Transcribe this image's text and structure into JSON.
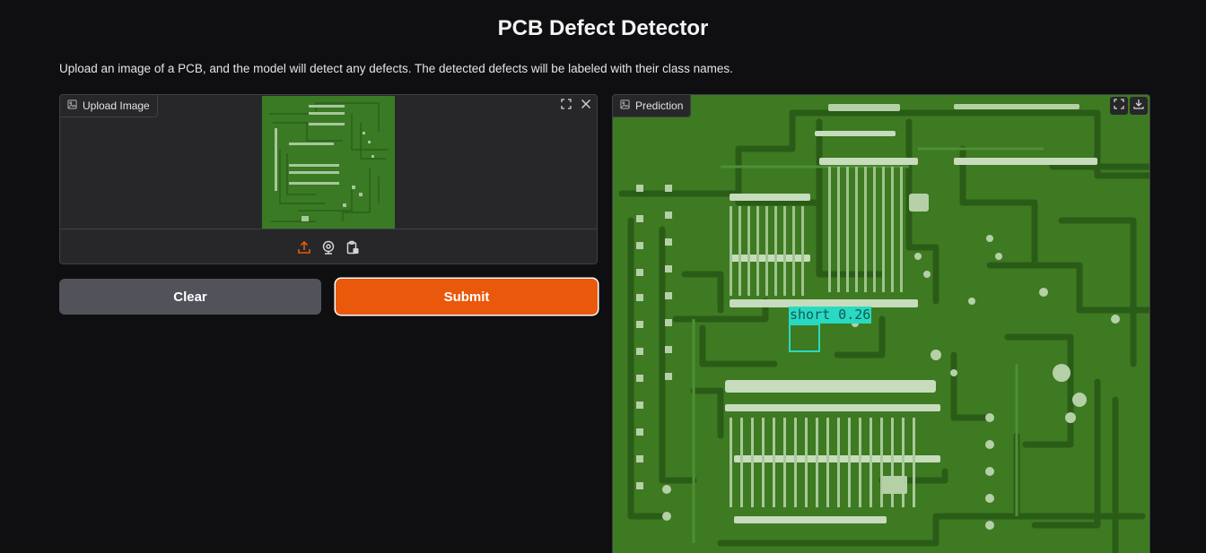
{
  "header": {
    "title": "PCB Defect Detector",
    "description": "Upload an image of a PCB, and the model will detect any defects. The detected defects will be labeled with their class names."
  },
  "upload": {
    "label": "Upload Image",
    "label_icon": "image-icon",
    "corner_buttons": [
      "fullscreen-icon",
      "close-icon"
    ],
    "toolbar_icons": [
      "upload-icon",
      "webcam-icon",
      "clipboard-icon"
    ],
    "active_color": "#ea580c"
  },
  "buttons": {
    "clear": "Clear",
    "submit": "Submit",
    "submit_color": "#ea580c",
    "clear_color": "#52525b"
  },
  "prediction": {
    "label": "Prediction",
    "label_icon": "image-icon",
    "corner_buttons": [
      "fullscreen-icon",
      "download-icon"
    ],
    "detections": [
      {
        "class": "short",
        "score": "0.26",
        "text": "short 0.26",
        "color": "#29d9c2"
      }
    ]
  }
}
